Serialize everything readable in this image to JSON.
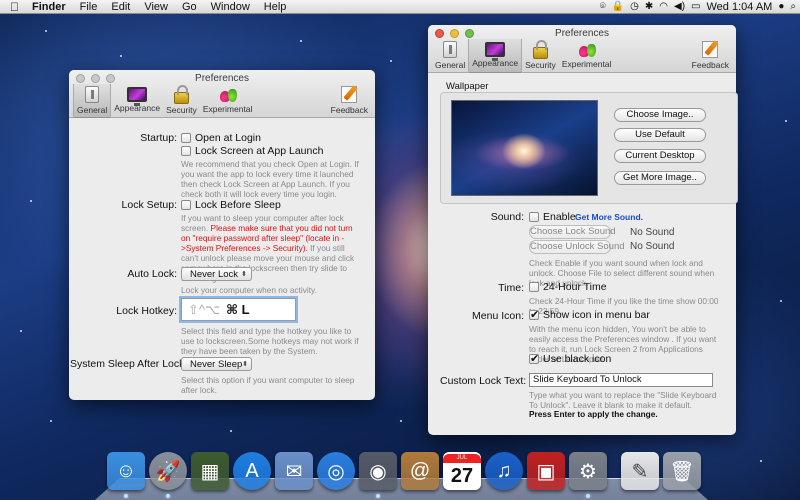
{
  "menubar": {
    "apple_icon": "apple-logo",
    "app_name": "Finder",
    "items": [
      "File",
      "Edit",
      "View",
      "Go",
      "Window",
      "Help"
    ],
    "clock": "Wed 1:04 AM",
    "status_icons": [
      "fingerprint-icon",
      "lock-icon",
      "time-machine-icon",
      "bluetooth-icon",
      "wifi-icon",
      "volume-icon",
      "battery-icon",
      "user-icon",
      "spotlight-icon"
    ]
  },
  "win_left": {
    "title": "Preferences",
    "toolbar": {
      "general": "General",
      "appearance": "Appearance",
      "security": "Security",
      "experimental": "Experimental",
      "feedback": "Feedback"
    },
    "selected_tab": "General",
    "startup": {
      "label": "Startup:",
      "open_login": "Open at Login",
      "lock_launch": "Lock Screen at App Launch",
      "help": "We recommend that you check Open at Login. If you want the app to lock every time it launched then check Lock Screen at App Launch. If you check both it will lock every time you login."
    },
    "lock_setup": {
      "label": "Lock Setup:",
      "lock_sleep": "Lock Before Sleep",
      "help1": "If you want to sleep your computer after lock screen.",
      "help_warn": "Please make sure that you did not turn on \"require password after sleep\" (locate in  ->System Preferences -> Security).",
      "help2": "If you still can't unlock please move your mouse and click somewhere in the lockscreen then try slide to unlock again."
    },
    "auto_lock": {
      "label": "Auto Lock:",
      "value": "Never Lock",
      "help": "Lock your computer when no activity."
    },
    "hotkey": {
      "label": "Lock Hotkey:",
      "ghost": "⇧^⌥",
      "keys": "⌘ L",
      "help": "Select this field and type the hotkey you like to use to lockscreen.Some hotkeys may not work if they have been taken by the System."
    },
    "sleep_after": {
      "label": "System Sleep After Lock:",
      "value": "Never Sleep",
      "help": "Select this option if you want computer to sleep after lock."
    }
  },
  "win_right": {
    "title": "Preferences",
    "toolbar": {
      "general": "General",
      "appearance": "Appearance",
      "security": "Security",
      "experimental": "Experimental",
      "feedback": "Feedback"
    },
    "selected_tab": "Appearance",
    "wallpaper": {
      "label": "Wallpaper",
      "choose": "Choose Image..",
      "default": "Use Default",
      "current": "Current Desktop",
      "more": "Get More Image.."
    },
    "sound": {
      "label": "Sound:",
      "enable": "Enable",
      "link": "Get More Sound.",
      "choose_lock": "Choose Lock Sound",
      "choose_lock_value": "No Sound",
      "choose_unlock": "Choose Unlock Sound",
      "choose_unlock_value": "No Sound",
      "help": "Check Enable if you want sound when lock and unlock. Choose File to select different sound when lock and unlock."
    },
    "time": {
      "label": "Time:",
      "option": "24-Hour Time",
      "help": "Check 24-Hour Time if you like the time show 00:00 to 23:59."
    },
    "menu_icon": {
      "label": "Menu Icon:",
      "show": "Show icon in menu bar",
      "show_checked": true,
      "help": "With the menu icon hidden, You won't be able to easily access the Preferences window . If you want to reach it, run Lock Screen 2 from Applications folder or Launchpad.",
      "black": "Use black icon",
      "black_checked": true
    },
    "custom_text": {
      "label": "Custom Lock Text:",
      "value": "Slide Keyboard To Unlock",
      "help": "Type what you want to replace the \"Slide Keyboard To Unlock\". Leave it blank to make it default.",
      "note": "Press Enter to apply the change."
    }
  },
  "dock": {
    "items": [
      {
        "name": "finder",
        "glyph": "☺",
        "color": "#3a8fe0"
      },
      {
        "name": "launchpad",
        "glyph": "🚀",
        "color": "#8a8f99"
      },
      {
        "name": "mission-control",
        "glyph": "▦",
        "color": "#3e5a2e"
      },
      {
        "name": "app-store",
        "glyph": "A",
        "color": "#1e7ee0"
      },
      {
        "name": "mail-hawk",
        "glyph": "✉",
        "color": "#6a8fc8"
      },
      {
        "name": "safari",
        "glyph": "◎",
        "color": "#2a7de0"
      },
      {
        "name": "facetime",
        "glyph": "◉",
        "color": "#555a66"
      },
      {
        "name": "address-book",
        "glyph": "@",
        "color": "#b07a3a"
      },
      {
        "name": "ical",
        "glyph": "27",
        "color": "#ffffff"
      },
      {
        "name": "itunes",
        "glyph": "♫",
        "color": "#1a5fc8"
      },
      {
        "name": "photo-booth",
        "glyph": "▣",
        "color": "#c02020"
      },
      {
        "name": "system-preferences",
        "glyph": "⚙",
        "color": "#7a7f88"
      },
      {
        "name": "document",
        "glyph": "✎",
        "color": "#e8e8e8"
      },
      {
        "name": "trash",
        "glyph": "🗑",
        "color": "#9aa0a8"
      }
    ],
    "calendar_month": "JUL"
  }
}
